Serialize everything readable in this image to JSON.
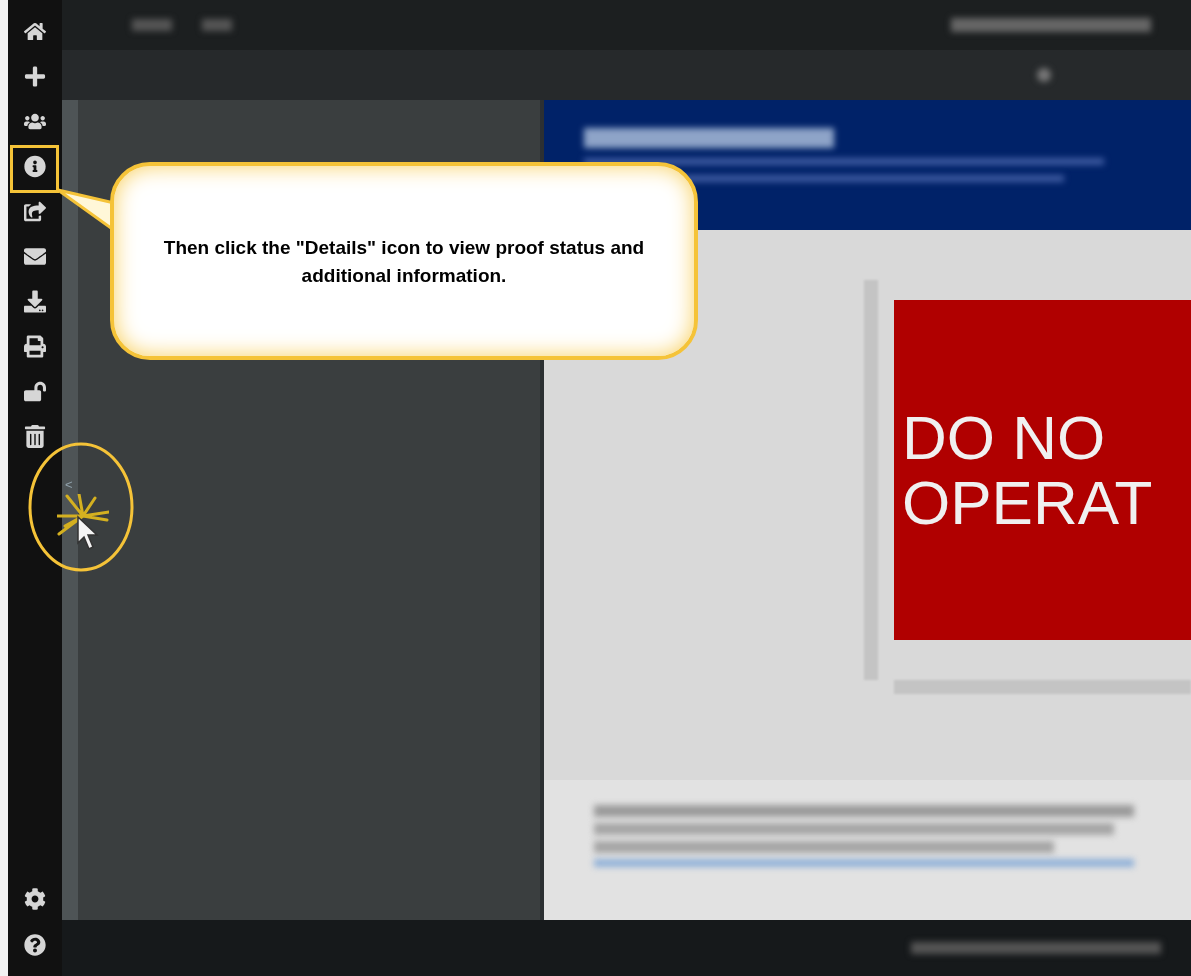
{
  "callout": {
    "text": "Then click the \"Details\" icon to view proof status and additional information."
  },
  "panel_toggle": {
    "label": "<"
  },
  "proof": {
    "sign_lines": [
      "DO NO",
      "OPERAT"
    ]
  }
}
